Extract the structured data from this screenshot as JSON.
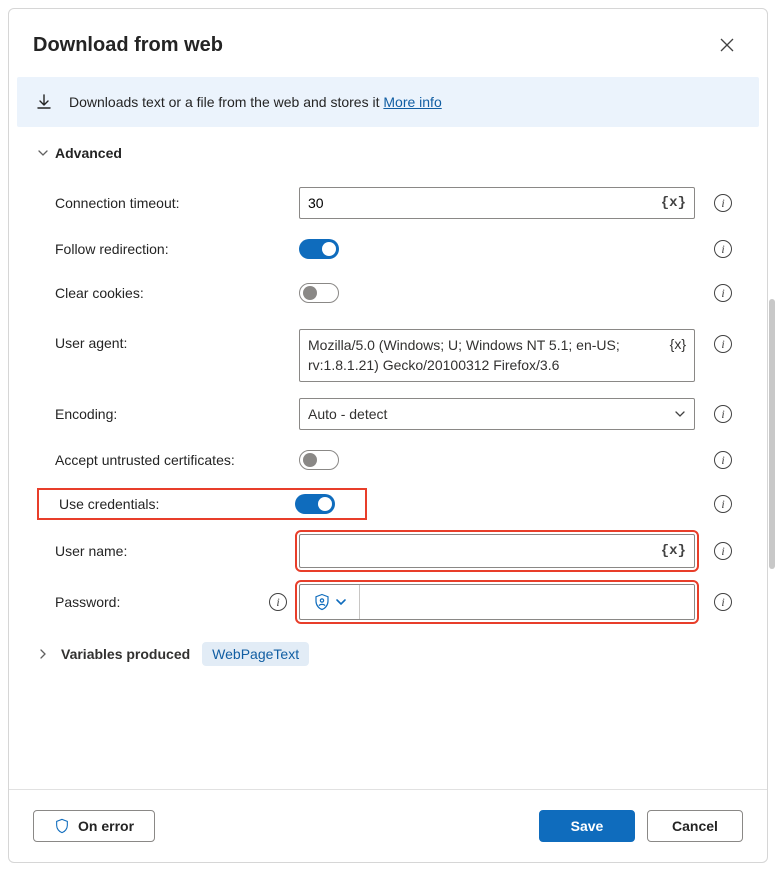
{
  "title": "Download from web",
  "banner": {
    "text": "Downloads text or a file from the web and stores it ",
    "more": "More info"
  },
  "sections": {
    "advanced": "Advanced",
    "variables_produced": "Variables produced"
  },
  "fields": {
    "connection_timeout": {
      "label": "Connection timeout:",
      "value": "30"
    },
    "follow_redirection": {
      "label": "Follow redirection:",
      "on": true
    },
    "clear_cookies": {
      "label": "Clear cookies:",
      "on": false
    },
    "user_agent": {
      "label": "User agent:",
      "value": "Mozilla/5.0 (Windows; U; Windows NT 5.1; en-US; rv:1.8.1.21) Gecko/20100312 Firefox/3.6"
    },
    "encoding": {
      "label": "Encoding:",
      "value": "Auto - detect"
    },
    "accept_untrusted": {
      "label": "Accept untrusted certificates:",
      "on": false
    },
    "use_credentials": {
      "label": "Use credentials:",
      "on": true
    },
    "user_name": {
      "label": "User name:",
      "value": ""
    },
    "password": {
      "label": "Password:",
      "value": ""
    }
  },
  "variable_chip": "WebPageText",
  "buttons": {
    "on_error": "On error",
    "save": "Save",
    "cancel": "Cancel"
  }
}
